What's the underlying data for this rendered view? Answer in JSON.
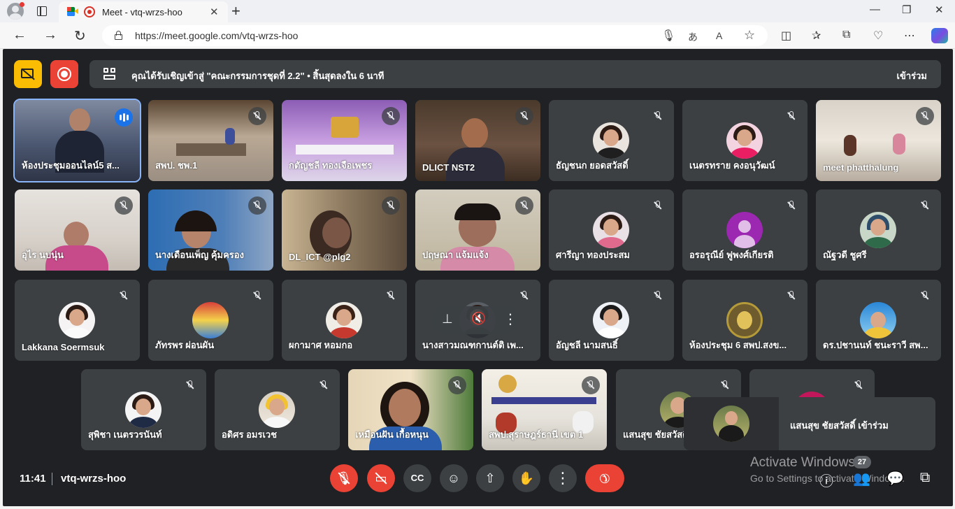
{
  "browser": {
    "tab_title": "Meet - vtq-wrzs-hoo",
    "tab_close": "✕",
    "new_tab": "+",
    "url": "https://meet.google.com/vtq-wrzs-hoo",
    "minimize": "—",
    "restore": "❐",
    "close": "✕"
  },
  "banner": {
    "text": "คุณได้รับเชิญเข้าสู่ \"คณะกรรมการชุดที่ 2.2\"  •  สิ้นสุดลงใน 6 นาที",
    "join_label": "เข้าร่วม"
  },
  "participants": [
    {
      "name": "ห้องประชุมออนไลน์5 ส...",
      "type": "video",
      "speaking": true
    },
    {
      "name": "สพป. ชพ.1",
      "type": "video"
    },
    {
      "name": "กตัญชลี ทองเจือเพชร",
      "type": "video"
    },
    {
      "name": "DLICT NST2",
      "type": "video"
    },
    {
      "name": "ธัญชนก ยอดสวัสดิ์",
      "type": "avatar"
    },
    {
      "name": "เนตรทราย คงอนุวัฒน์",
      "type": "avatar"
    },
    {
      "name": "meet phatthalung",
      "type": "video"
    },
    {
      "name": "อุไร นบนุ่น",
      "type": "video"
    },
    {
      "name": "นางเดือนเพ็ญ คุ้มครอง",
      "type": "video"
    },
    {
      "name": "DL_ICT @plg2",
      "type": "video"
    },
    {
      "name": "ปฤษณา แจ้มแจ้ง",
      "type": "video"
    },
    {
      "name": "ศารีญา ทองประสม",
      "type": "avatar"
    },
    {
      "name": "อรอรุณีย์ ฟูพงศ์เกียรติ",
      "type": "avatar-default"
    },
    {
      "name": "ณัฐวดี ชูศรี",
      "type": "avatar"
    },
    {
      "name": "Lakkana Soermsuk",
      "type": "avatar"
    },
    {
      "name": "ภัทรพร ผ่อนผัน",
      "type": "avatar"
    },
    {
      "name": "ผกามาศ หอมกอ",
      "type": "avatar"
    },
    {
      "name": "นางสาวมณฑกานต์ติ เพ...",
      "type": "avatar",
      "hover": true
    },
    {
      "name": "อัญชลี นามสนธิ์",
      "type": "avatar"
    },
    {
      "name": "ห้องประชุม 6 สพป.สงข...",
      "type": "avatar"
    },
    {
      "name": "ดร.ปชานนท์ ชนะราวี สพ...",
      "type": "avatar"
    },
    {
      "name": "สุพิชา เนตรวรนันท์",
      "type": "avatar"
    },
    {
      "name": "อดิศร อมรเวช",
      "type": "avatar"
    },
    {
      "name": "เหมือนฝัน เกื้อหนุน",
      "type": "video"
    },
    {
      "name": "สพป.สุราษฎร์ธานี เขต 1",
      "type": "video"
    },
    {
      "name": "แสนสุข ชัยสวัสดิ์",
      "type": "avatar"
    },
    {
      "name": "",
      "type": "avatar"
    }
  ],
  "toast": {
    "text": "แสนสุข ชัยสวัสดิ์ เข้าร่วม"
  },
  "bottom": {
    "time": "11:41",
    "meeting_code": "vtq-wrzs-hoo",
    "participant_count": "27"
  },
  "watermark": {
    "line1": "Activate Windows",
    "line2": "Go to Settings to activate Windows."
  },
  "colors": {
    "accent": "#1a73e8",
    "danger": "#ea4335",
    "surface": "#3c4043",
    "background": "#202124"
  }
}
